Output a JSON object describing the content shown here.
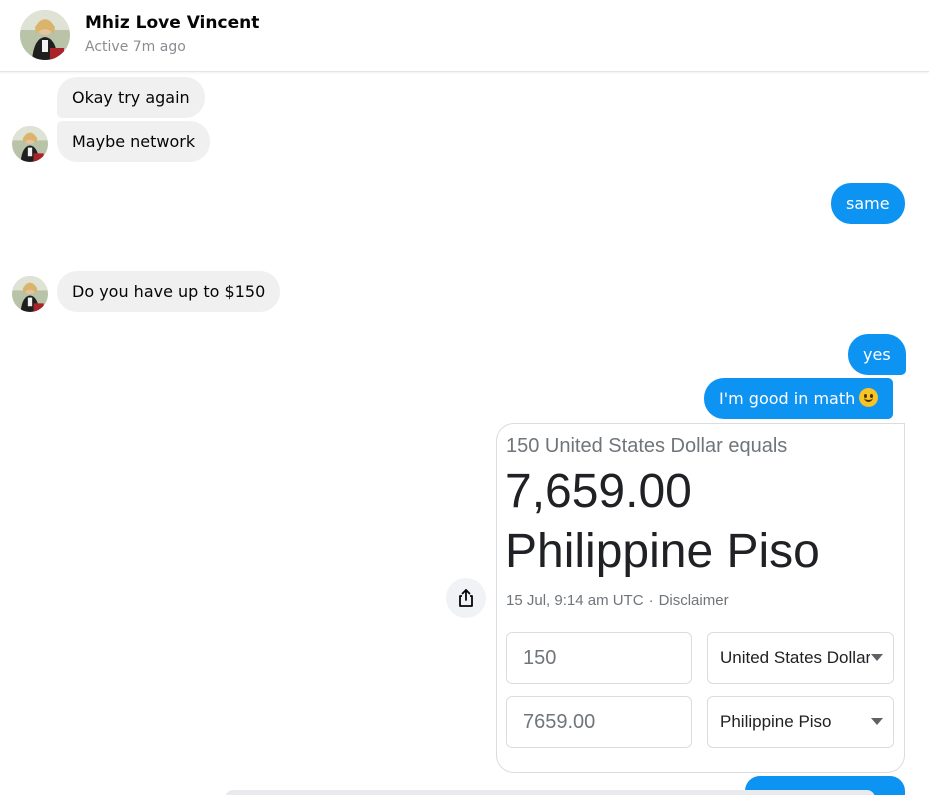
{
  "header": {
    "name": "Mhiz Love Vincent",
    "status": "Active 7m ago"
  },
  "messages": {
    "m1": "Okay try again",
    "m2": "Maybe network",
    "m3": "same",
    "m4": "Do you have up to $150",
    "m5": "yes",
    "m6": "I'm good in math"
  },
  "card": {
    "subtitle": "150 United States Dollar equals",
    "amount": "7,659.00",
    "currency": "Philippine Piso",
    "timestamp": "15 Jul, 9:14 am UTC",
    "separator": "·",
    "disclaimer": "Disclaimer",
    "from_value": "150",
    "from_currency": "United States Dollar",
    "to_value": "7659.00",
    "to_currency": "Philippine Piso"
  },
  "colors": {
    "outgoing": "#0d93f2",
    "incoming": "#f0f0f0"
  },
  "icons": {
    "share": "share-icon",
    "emoji": "smiley-emoji-icon"
  }
}
